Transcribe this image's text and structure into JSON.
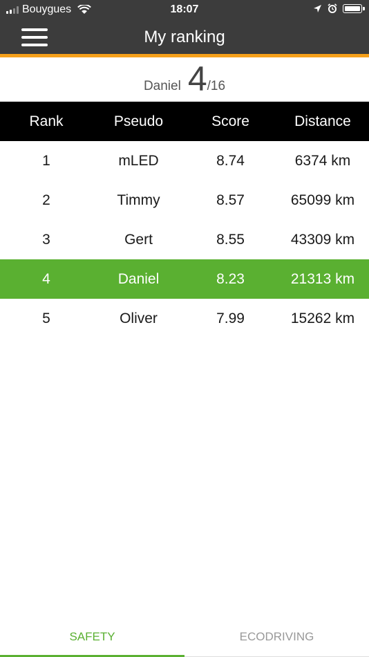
{
  "status_bar": {
    "carrier": "Bouygues",
    "time": "18:07"
  },
  "nav": {
    "title": "My ranking",
    "menu_icon": "hamburger-menu-icon"
  },
  "summary": {
    "name": "Daniel",
    "rank": "4",
    "total": "/16"
  },
  "table": {
    "headers": [
      "Rank",
      "Pseudo",
      "Score",
      "Distance"
    ],
    "rows": [
      {
        "rank": "1",
        "pseudo": "mLED",
        "score": "8.74",
        "distance": "6374 km"
      },
      {
        "rank": "2",
        "pseudo": "Timmy",
        "score": "8.57",
        "distance": "65099 km"
      },
      {
        "rank": "3",
        "pseudo": "Gert",
        "score": "8.55",
        "distance": "43309 km"
      },
      {
        "rank": "4",
        "pseudo": "Daniel",
        "score": "8.23",
        "distance": "21313 km"
      },
      {
        "rank": "5",
        "pseudo": "Oliver",
        "score": "7.99",
        "distance": "15262 km"
      }
    ],
    "highlighted_row_index": 3
  },
  "tabs": [
    {
      "label": "SAFETY",
      "active": true
    },
    {
      "label": "ECODRIVING",
      "active": false
    }
  ],
  "colors": {
    "header_bg": "#3c3c3c",
    "accent": "#f5a01a",
    "highlight": "#5ab031",
    "table_header_bg": "#000000"
  }
}
